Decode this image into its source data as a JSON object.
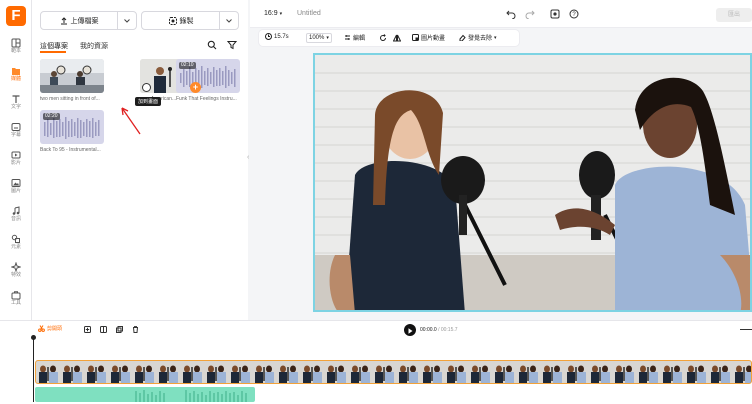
{
  "rail": {
    "logo": "F",
    "items": [
      {
        "label": "範本",
        "icon": "template-icon"
      },
      {
        "label": "媒體",
        "icon": "folder-icon"
      },
      {
        "label": "文字",
        "icon": "text-icon"
      },
      {
        "label": "字幕",
        "icon": "subtitle-icon"
      },
      {
        "label": "影片",
        "icon": "video-icon"
      },
      {
        "label": "圖片",
        "icon": "image-icon"
      },
      {
        "label": "音訊",
        "icon": "music-icon"
      },
      {
        "label": "元素",
        "icon": "shapes-icon"
      },
      {
        "label": "特效",
        "icon": "effects-icon"
      },
      {
        "label": "工具",
        "icon": "toolbox-icon"
      }
    ]
  },
  "panel": {
    "upload_label": "上傳檔案",
    "record_label": "錄製",
    "tabs": [
      "這個專案",
      "我的資源"
    ],
    "media": [
      {
        "caption": "two men sitting in front of...",
        "kind": "video"
      },
      {
        "caption": "...an American...",
        "kind": "video"
      },
      {
        "caption": "Funk That Feelings Instru...",
        "kind": "audio",
        "duration": "02:10"
      },
      {
        "caption": "Back To 95 - Instrumental...",
        "kind": "audio",
        "duration": "02:20"
      }
    ],
    "tooltip": "加到畫面"
  },
  "topbar": {
    "ratio": "16:9",
    "title": "Untitled",
    "export_label": "匯出"
  },
  "edit_tools": {
    "duration": "15.7s",
    "zoom": "100%",
    "edit_label": "編輯",
    "pip_label": "圖片動畫",
    "remove_bg_label": "發覺去除"
  },
  "timeline": {
    "split_label": "剪開頭",
    "current_time": "00:00.0",
    "total_time": "00:15.7"
  },
  "colors": {
    "accent": "#ff6a00",
    "canvas_border": "#7dd3e3",
    "audio_track": "#7fe0c0",
    "video_track_border": "#f2a23a"
  }
}
